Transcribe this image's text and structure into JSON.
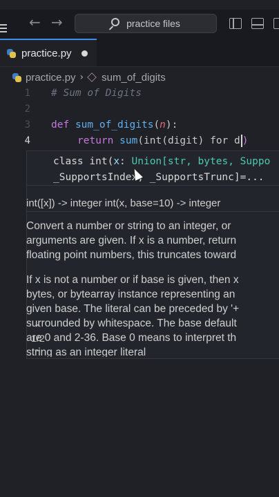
{
  "titlebar": {
    "search_label": "practice files"
  },
  "tab": {
    "label": "practice.py"
  },
  "breadcrumb": {
    "file": "practice.py",
    "symbol": "sum_of_digits"
  },
  "editor": {
    "lines": [
      {
        "num": "1",
        "comment": "# Sum of Digits"
      },
      {
        "num": "2"
      },
      {
        "num": "3",
        "kw": "def",
        "fn": "sum_of_digits",
        "open": "(",
        "param": "n",
        "close": "):"
      },
      {
        "num": "4",
        "kw": "return",
        "fn": "sum",
        "rest_1": "(int(digit) for d",
        "rest_2": ")"
      }
    ]
  },
  "hover": {
    "sig_line1_prefix": "class int(",
    "sig_line1_param": "x",
    "sig_line1_colon": ": ",
    "sig_line1_type": "Union[str, bytes, Suppo",
    "sig_line2": "_SupportsIndex, _SupportsTrunc]=...",
    "overload": "1/2",
    "usage": "int([x]) -> integer int(x, base=10) -> integer",
    "doc_para1": [
      "Convert a number or string to an integer, or",
      "arguments are given. If x is a number, return",
      "floating point numbers, this truncates toward"
    ],
    "doc_para2": [
      "If x is not a number or if base is given, then x",
      "bytes, or bytearray instance representing an",
      "given base. The literal can be preceded by '+",
      "surrounded by whitespace. The base default",
      "are 0 and 2-36. Base 0 means to interpret th",
      "string as an integer literal"
    ]
  },
  "colors": {
    "background": "#1f2127",
    "keyword": "#c678dd",
    "function": "#61afef",
    "comment": "#6c7480",
    "accent": "#3b8eea"
  }
}
